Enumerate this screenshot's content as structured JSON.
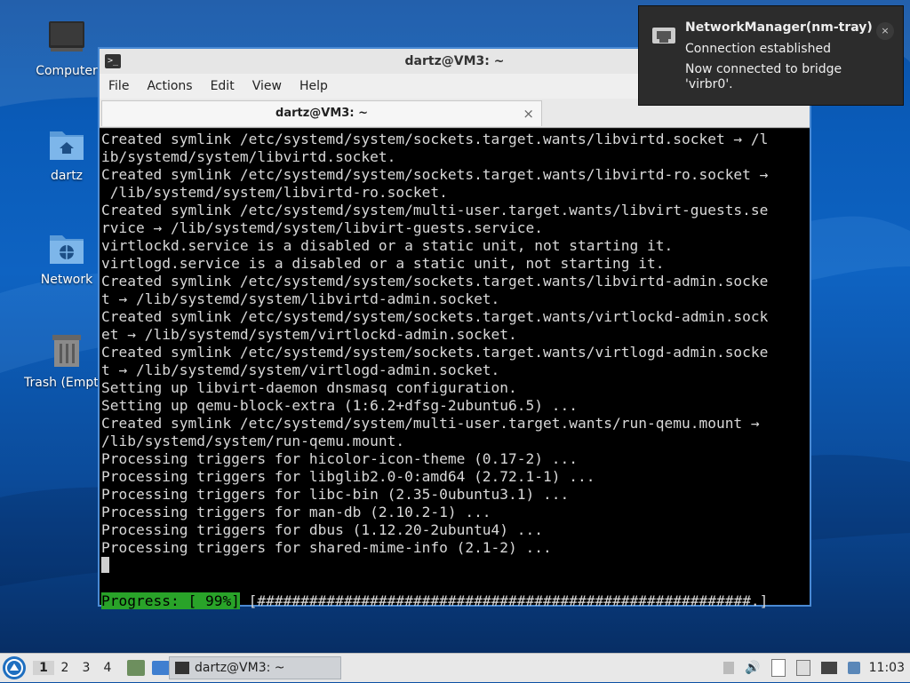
{
  "desktop": {
    "icons": [
      {
        "label": "Computer",
        "icon": "computer-icon"
      },
      {
        "label": "dartz",
        "icon": "home-folder-icon"
      },
      {
        "label": "Network",
        "icon": "network-folder-icon"
      },
      {
        "label": "Trash (Empty)",
        "icon": "trash-icon"
      }
    ]
  },
  "terminal": {
    "title": "dartz@VM3: ~",
    "menu": [
      "File",
      "Actions",
      "Edit",
      "View",
      "Help"
    ],
    "tab_label": "dartz@VM3: ~",
    "lines": [
      "Created symlink /etc/systemd/system/sockets.target.wants/libvirtd.socket → /l",
      "ib/systemd/system/libvirtd.socket.",
      "Created symlink /etc/systemd/system/sockets.target.wants/libvirtd-ro.socket →",
      " /lib/systemd/system/libvirtd-ro.socket.",
      "Created symlink /etc/systemd/system/multi-user.target.wants/libvirt-guests.se",
      "rvice → /lib/systemd/system/libvirt-guests.service.",
      "virtlockd.service is a disabled or a static unit, not starting it.",
      "virtlogd.service is a disabled or a static unit, not starting it.",
      "Created symlink /etc/systemd/system/sockets.target.wants/libvirtd-admin.socke",
      "t → /lib/systemd/system/libvirtd-admin.socket.",
      "Created symlink /etc/systemd/system/sockets.target.wants/virtlockd-admin.sock",
      "et → /lib/systemd/system/virtlockd-admin.socket.",
      "Created symlink /etc/systemd/system/sockets.target.wants/virtlogd-admin.socke",
      "t → /lib/systemd/system/virtlogd-admin.socket.",
      "Setting up libvirt-daemon dnsmasq configuration.",
      "Setting up qemu-block-extra (1:6.2+dfsg-2ubuntu6.5) ...",
      "Created symlink /etc/systemd/system/multi-user.target.wants/run-qemu.mount →",
      "/lib/systemd/system/run-qemu.mount.",
      "Processing triggers for hicolor-icon-theme (0.17-2) ...",
      "Processing triggers for libglib2.0-0:amd64 (2.72.1-1) ...",
      "Processing triggers for libc-bin (2.35-0ubuntu3.1) ...",
      "Processing triggers for man-db (2.10.2-1) ...",
      "Processing triggers for dbus (1.12.20-2ubuntu4) ...",
      "Processing triggers for shared-mime-info (2.1-2) ..."
    ],
    "progress_label": "Progress: [ 99%]",
    "progress_bar": " [#########################################################.]",
    "progress_value": 0.99
  },
  "notification": {
    "app": "NetworkManager(nm-tray)",
    "line1": "Connection established",
    "line2": "Now connected to bridge 'virbr0'.",
    "close": "×"
  },
  "taskbar": {
    "workspaces": [
      "1",
      "2",
      "3",
      "4"
    ],
    "task_label": "dartz@VM3: ~",
    "clock": "11:03"
  },
  "colors": {
    "accent": "#4a8ad4",
    "progress_green": "#29a329",
    "terminal_bg": "#000000"
  }
}
